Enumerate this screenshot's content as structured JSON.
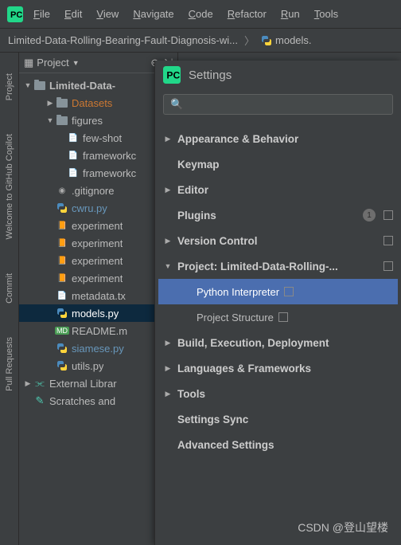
{
  "menubar": {
    "items": [
      "File",
      "Edit",
      "View",
      "Navigate",
      "Code",
      "Refactor",
      "Run",
      "Tools"
    ]
  },
  "breadcrumb": {
    "project": "Limited-Data-Rolling-Bearing-Fault-Diagnosis-wi...",
    "file": "models."
  },
  "project_panel": {
    "title": "Project"
  },
  "vtabs": {
    "t0": "Project",
    "t1": "Welcome to GitHub Copilot",
    "t2": "Commit",
    "t3": "Pull Requests"
  },
  "tree": {
    "root": "Limited-Data-",
    "items": [
      {
        "label": "Datasets",
        "type": "folder-orange",
        "indent": 1,
        "arrow": "▶"
      },
      {
        "label": "figures",
        "type": "folder",
        "indent": 1,
        "arrow": "▼"
      },
      {
        "label": "few-shot",
        "type": "file",
        "indent": 2,
        "arrow": ""
      },
      {
        "label": "frameworkc",
        "type": "file",
        "indent": 2,
        "arrow": ""
      },
      {
        "label": "frameworkc",
        "type": "file",
        "indent": 2,
        "arrow": ""
      },
      {
        "label": ".gitignore",
        "type": "git",
        "indent": 1,
        "arrow": ""
      },
      {
        "label": "cwru.py",
        "type": "py-blue",
        "indent": 1,
        "arrow": ""
      },
      {
        "label": "experiment",
        "type": "nb",
        "indent": 1,
        "arrow": ""
      },
      {
        "label": "experiment",
        "type": "nb",
        "indent": 1,
        "arrow": ""
      },
      {
        "label": "experiment",
        "type": "nb",
        "indent": 1,
        "arrow": ""
      },
      {
        "label": "experiment",
        "type": "nb",
        "indent": 1,
        "arrow": ""
      },
      {
        "label": "metadata.tx",
        "type": "txt",
        "indent": 1,
        "arrow": ""
      },
      {
        "label": "models.py",
        "type": "py",
        "indent": 1,
        "arrow": "",
        "selected": true
      },
      {
        "label": "README.m",
        "type": "md",
        "indent": 1,
        "arrow": ""
      },
      {
        "label": "siamese.py",
        "type": "py-blue",
        "indent": 1,
        "arrow": ""
      },
      {
        "label": "utils.py",
        "type": "py",
        "indent": 1,
        "arrow": ""
      }
    ],
    "external": "External Librar",
    "scratches": "Scratches and"
  },
  "settings": {
    "title": "Settings",
    "search_placeholder": "",
    "rows": [
      {
        "label": "Appearance & Behavior",
        "arrow": "▶",
        "top": true
      },
      {
        "label": "Keymap",
        "arrow": "",
        "top": true
      },
      {
        "label": "Editor",
        "arrow": "▶",
        "top": true
      },
      {
        "label": "Plugins",
        "arrow": "",
        "top": true,
        "badge": "1",
        "square": true
      },
      {
        "label": "Version Control",
        "arrow": "▶",
        "top": true,
        "square": true
      },
      {
        "label": "Project: Limited-Data-Rolling-...",
        "arrow": "▼",
        "top": true,
        "square": true
      },
      {
        "label": "Python Interpreter",
        "arrow": "",
        "sub": true,
        "selected": true,
        "square": true
      },
      {
        "label": "Project Structure",
        "arrow": "",
        "sub": true,
        "square": true
      },
      {
        "label": "Build, Execution, Deployment",
        "arrow": "▶",
        "top": true
      },
      {
        "label": "Languages & Frameworks",
        "arrow": "▶",
        "top": true
      },
      {
        "label": "Tools",
        "arrow": "▶",
        "top": true
      },
      {
        "label": "Settings Sync",
        "arrow": "",
        "top": true
      },
      {
        "label": "Advanced Settings",
        "arrow": "",
        "top": true
      }
    ]
  },
  "watermark": "CSDN @登山望楼"
}
